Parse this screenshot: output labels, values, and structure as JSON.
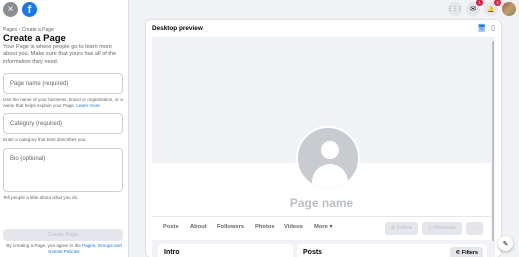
{
  "left": {
    "breadcrumb": "Pages › Create a Page",
    "title": "Create a Page",
    "description": "Your Page is where people go to learn more about you. Make sure that yours has all of the information they need.",
    "page_name_placeholder": "Page name (required)",
    "page_name_help": "Use the name of your business, brand or organisation, or a name that helps explain your Page.",
    "learn_more": "Learn more",
    "category_placeholder": "Category (required)",
    "category_help": "Enter a category that best describes you.",
    "bio_placeholder": "Bio (optional)",
    "bio_help": "Tell people a little about what you do.",
    "create_button": "Create Page",
    "terms_prefix": "By creating a Page, you agree to the",
    "terms_link": "Pages, Groups and Events Policies"
  },
  "topbar": {
    "close_icon": "×",
    "fb_icon": "f",
    "menu_icon": "⋮⋮⋮",
    "messenger_icon": "✉",
    "messenger_badge": "1",
    "notif_icon": "🔔",
    "notif_badge": "4"
  },
  "preview": {
    "title": "Desktop preview",
    "desktop_icon": "🖥",
    "mobile_icon": "▯",
    "page_name": "Page name",
    "tabs": [
      "Posts",
      "About",
      "Followers",
      "Photos",
      "Videos",
      "More ▾"
    ],
    "follow": "Follow",
    "message": "Message",
    "more_dots": "···",
    "intro": "Intro",
    "posts": "Posts",
    "filters": "Filters",
    "compose_icon": "✎"
  }
}
